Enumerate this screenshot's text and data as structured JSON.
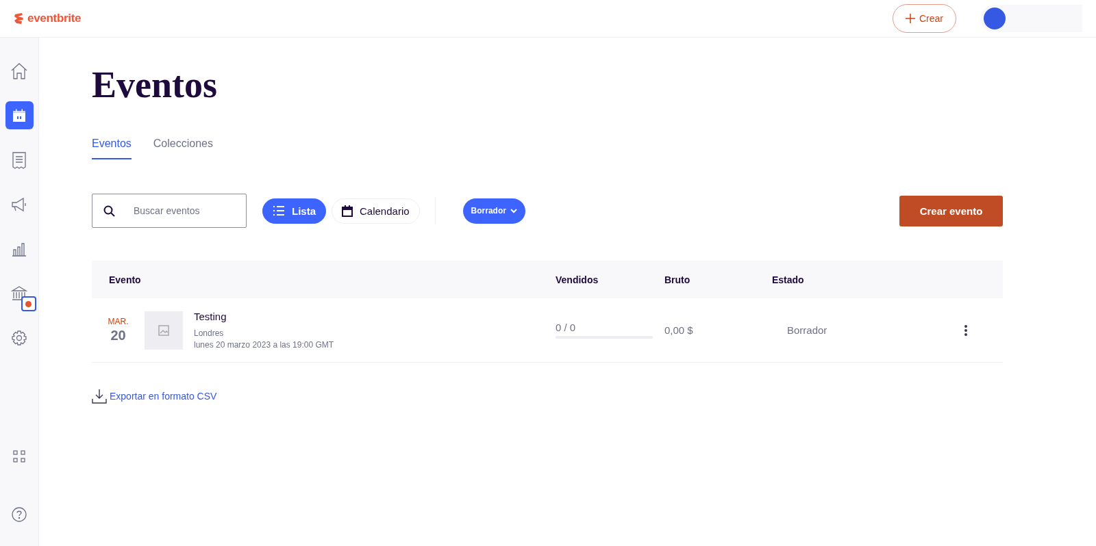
{
  "header": {
    "logo": "eventbrite",
    "create_button": "Crear"
  },
  "sidebar": {
    "items": [
      {
        "kind": "home",
        "selected": false,
        "alert": false
      },
      {
        "kind": "calendar",
        "selected": true,
        "alert": false
      },
      {
        "kind": "orders",
        "selected": false,
        "alert": false
      },
      {
        "kind": "marketing",
        "selected": false,
        "alert": false
      },
      {
        "kind": "reports",
        "selected": false,
        "alert": false
      },
      {
        "kind": "finance",
        "selected": false,
        "alert": true
      },
      {
        "kind": "settings",
        "selected": false,
        "alert": false
      }
    ],
    "bottom_items": [
      {
        "kind": "apps"
      },
      {
        "kind": "help"
      }
    ]
  },
  "page": {
    "title": "Eventos"
  },
  "tabs": [
    {
      "label": "Eventos",
      "selected": true
    },
    {
      "label": "Colecciones",
      "selected": false
    }
  ],
  "search": {
    "placeholder": "Buscar eventos"
  },
  "views": [
    {
      "kind": "list",
      "label": "Lista",
      "selected": true
    },
    {
      "kind": "calendar",
      "label": "Calendario",
      "selected": false
    }
  ],
  "filter": {
    "label": "Borrador"
  },
  "create_event_button": "Crear evento",
  "table": {
    "columns": [
      "Evento",
      "Vendidos",
      "Bruto",
      "Estado"
    ],
    "rows": [
      {
        "month": "MAR.",
        "day": "20",
        "title": "Testing",
        "location": "Londres",
        "datetime": "lunes 20 marzo 2023 a las 19:00 GMT",
        "sold": "0 / 0",
        "level": 0,
        "gross": "0,00 $",
        "status": "Borrador"
      }
    ]
  },
  "export_link": "Exportar en formato CSV"
}
